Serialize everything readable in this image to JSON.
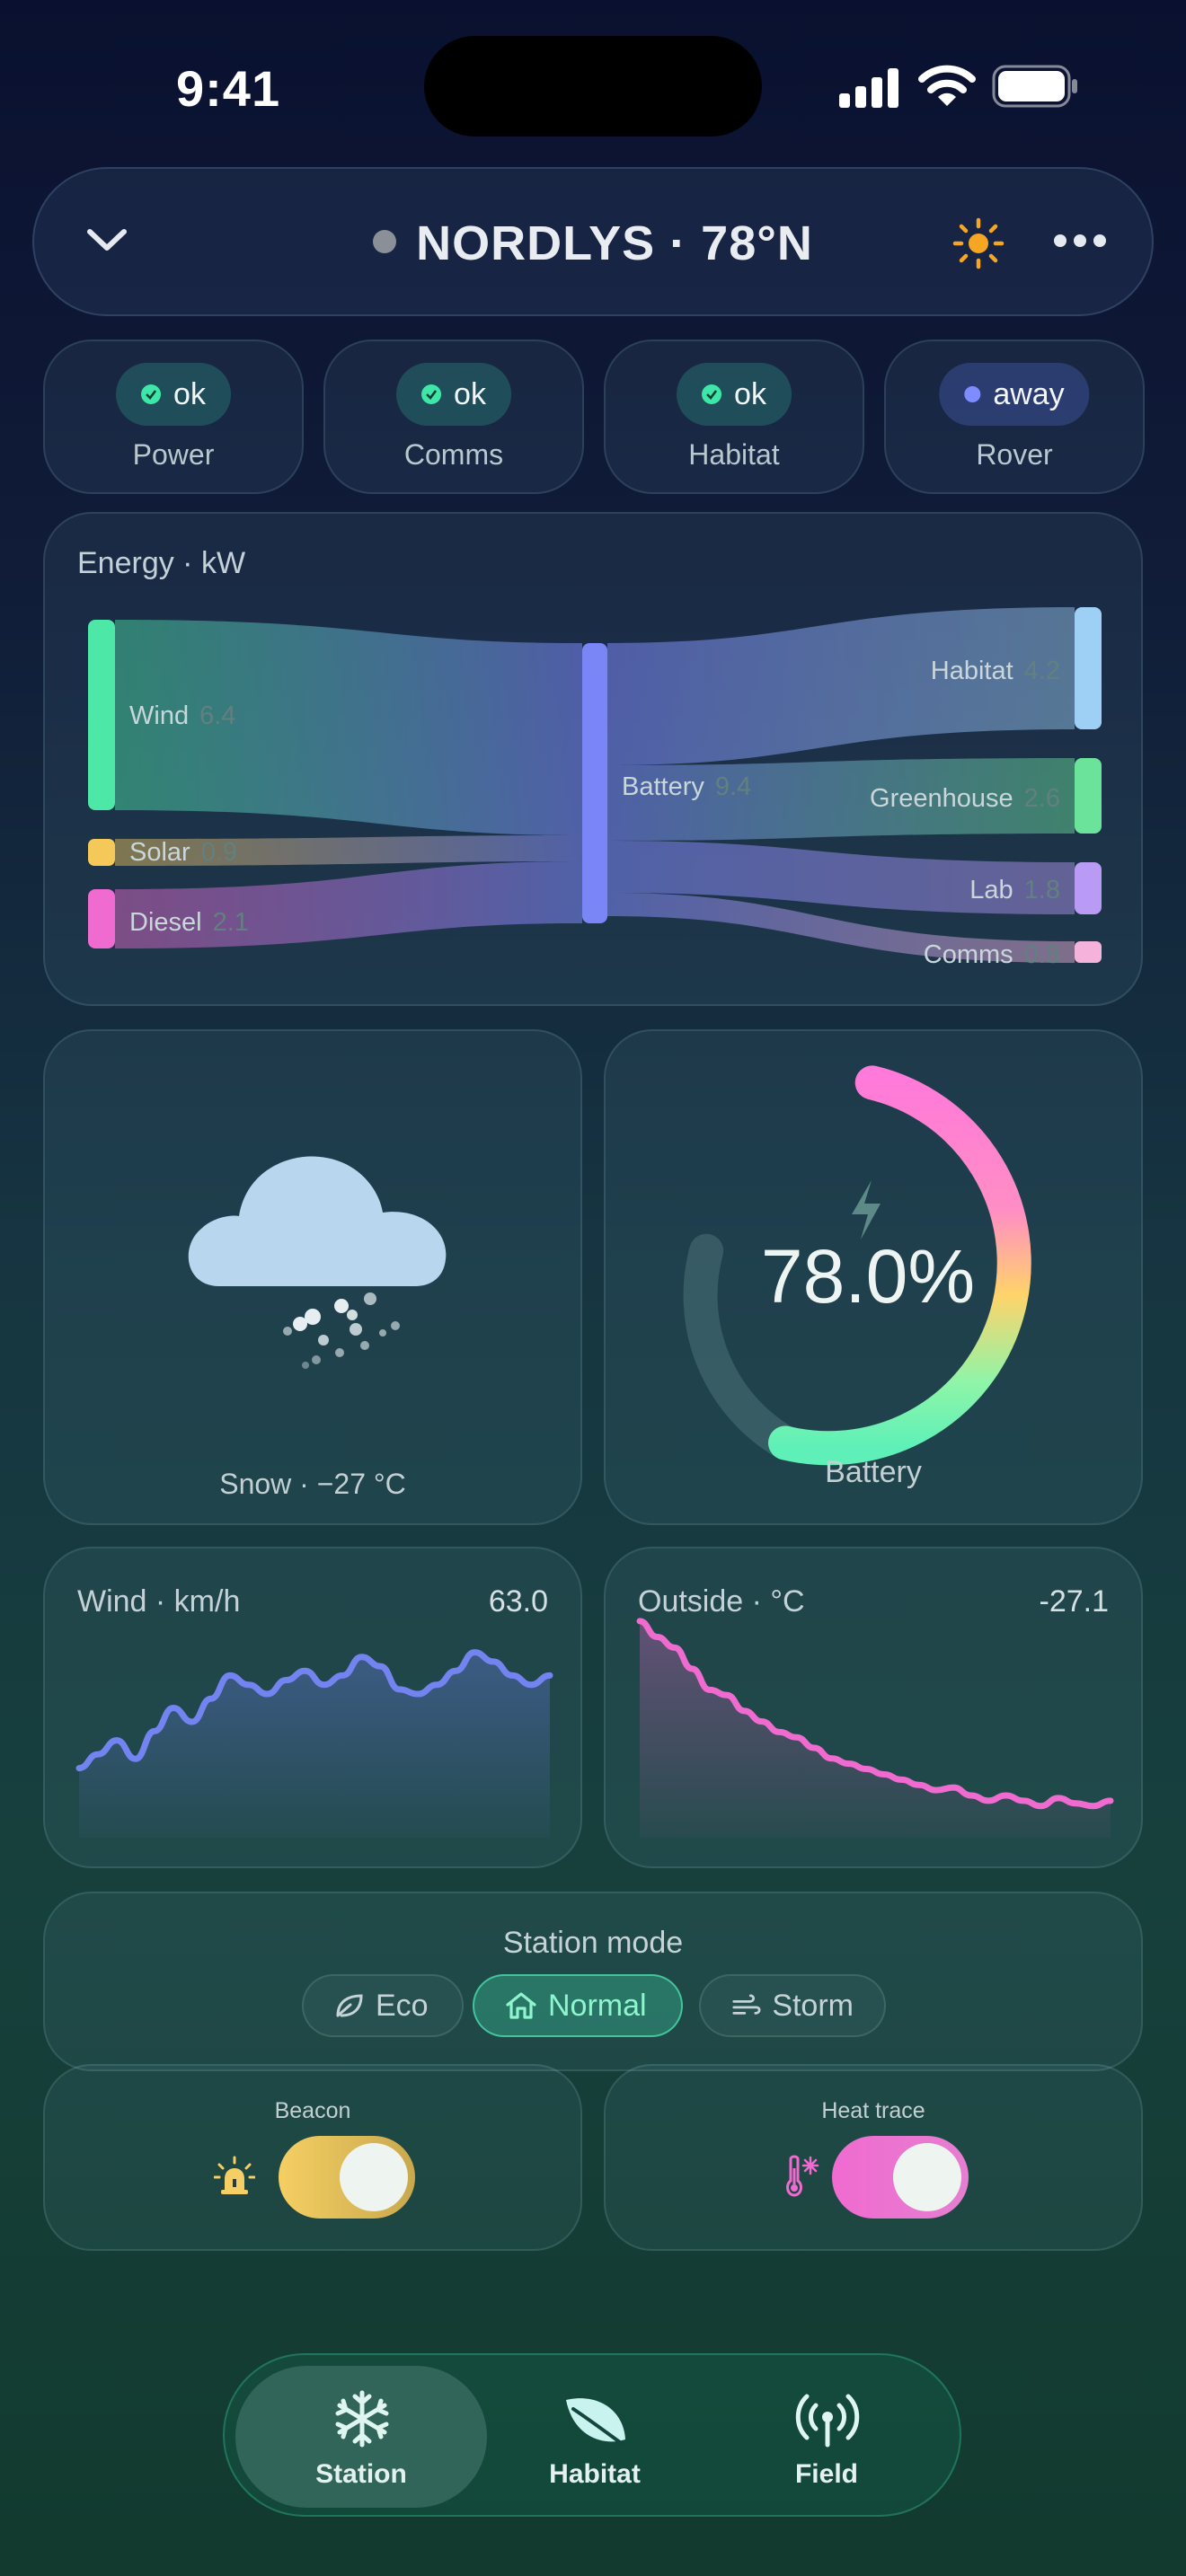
{
  "status_bar": {
    "time": "9:41"
  },
  "header": {
    "title": "NORDLYS · 78°N"
  },
  "systems": [
    {
      "status": "ok",
      "label": "Power"
    },
    {
      "status": "ok",
      "label": "Comms"
    },
    {
      "status": "ok",
      "label": "Habitat"
    },
    {
      "status": "away",
      "label": "Rover"
    }
  ],
  "energy": {
    "title": "Energy · kW",
    "sources": [
      {
        "name": "Wind",
        "value": "6.4",
        "color": "#4de8a8"
      },
      {
        "name": "Solar",
        "value": "0.9",
        "color": "#f5c85a"
      },
      {
        "name": "Diesel",
        "value": "2.1",
        "color": "#f06bd0"
      }
    ],
    "hub": {
      "name": "Battery",
      "value": "9.4",
      "color": "#7a86f5"
    },
    "sinks": [
      {
        "name": "Habitat",
        "value": "4.2",
        "color": "#9ed0f5"
      },
      {
        "name": "Greenhouse",
        "value": "2.6",
        "color": "#6be39a"
      },
      {
        "name": "Lab",
        "value": "1.8",
        "color": "#b99af5"
      },
      {
        "name": "Comms",
        "value": "0.8",
        "color": "#f5b3dc"
      }
    ]
  },
  "weather": {
    "label": "Snow · −27 °C"
  },
  "battery": {
    "value": "78.0%",
    "fraction": 0.78,
    "label": "Battery"
  },
  "wind_chart": {
    "title": "Wind · km/h",
    "current": "63.0"
  },
  "temp_chart": {
    "title": "Outside · °C",
    "current": "-27.1"
  },
  "chart_data": [
    {
      "type": "area",
      "title": "Wind · km/h",
      "color": "#7383f0",
      "y": [
        30,
        36,
        42,
        34,
        46,
        56,
        50,
        60,
        70,
        66,
        62,
        68,
        72,
        66,
        70,
        78,
        74,
        64,
        62,
        66,
        72,
        80,
        76,
        70,
        66,
        70
      ]
    },
    {
      "type": "area",
      "title": "Outside · °C",
      "color": "#f06bd0",
      "y": [
        82,
        76,
        72,
        64,
        56,
        54,
        48,
        44,
        40,
        38,
        34,
        30,
        28,
        26,
        24,
        22,
        20,
        18,
        19,
        16,
        14,
        16,
        14,
        12,
        15,
        13,
        12,
        14
      ]
    }
  ],
  "station_mode": {
    "title": "Station mode",
    "options": [
      {
        "label": "Eco",
        "active": false
      },
      {
        "label": "Normal",
        "active": true
      },
      {
        "label": "Storm",
        "active": false
      }
    ]
  },
  "beacon": {
    "label": "Beacon",
    "on": true,
    "color": "#f5cf63"
  },
  "heat_trace": {
    "label": "Heat trace",
    "on": true,
    "color": "#f06bd0"
  },
  "tabs": [
    {
      "label": "Station",
      "active": true
    },
    {
      "label": "Habitat",
      "active": false
    },
    {
      "label": "Field",
      "active": false
    }
  ]
}
